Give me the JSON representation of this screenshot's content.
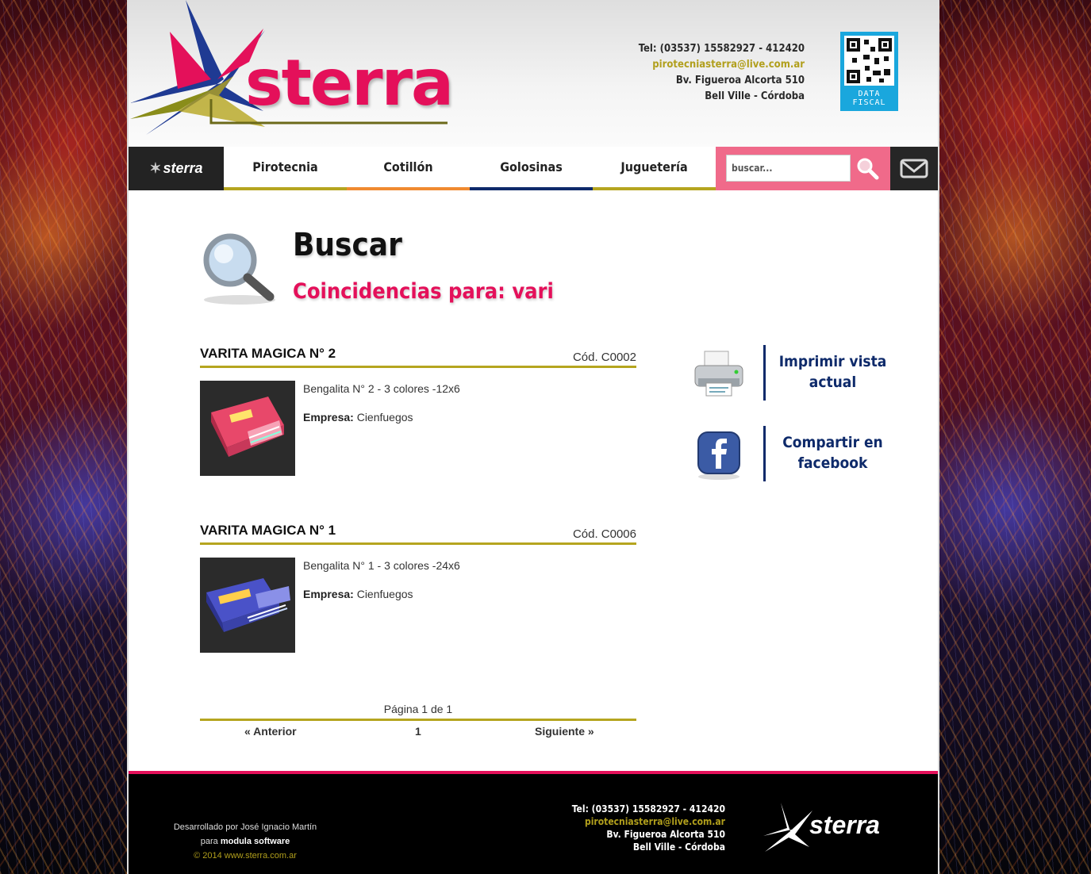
{
  "brand": {
    "name": "sterra",
    "colors": {
      "primary": "#e4105a",
      "accent": "#b5a51f",
      "navy": "#0e2a6a",
      "sky": "#1aa7dd"
    }
  },
  "header": {
    "phone": "Tel: (03537) 15582927 - 412420",
    "email": "pirotecniasterra@live.com.ar",
    "address": "Bv. Figueroa Alcorta 510",
    "city": "Bell Ville - Córdoba",
    "qr_label_1": "DATA",
    "qr_label_2": "FISCAL"
  },
  "nav": {
    "logo_label": "sterra",
    "items": [
      {
        "label": "Pirotecnia",
        "color": "#b5a51f"
      },
      {
        "label": "Cotillón",
        "color": "#f08a30"
      },
      {
        "label": "Golosinas",
        "color": "#0e2a6a"
      },
      {
        "label": "Juguetería",
        "color": "#b5a51f"
      }
    ],
    "search_placeholder": "buscar...",
    "search_icon": "magnifier-icon",
    "mail_icon": "envelope-icon"
  },
  "page": {
    "title": "Buscar",
    "subtitle": "Coincidencias para: vari"
  },
  "products": [
    {
      "name": "VARITA MAGICA N° 2",
      "code": "Cód. C0002",
      "description": "Bengalita N° 2 - 3 colores -12x6",
      "company_label": "Empresa:",
      "company": "Cienfuegos",
      "box_color": "#e8486a"
    },
    {
      "name": "VARITA MAGICA N° 1",
      "code": "Cód. C0006",
      "description": "Bengalita N° 1 - 3 colores -24x6",
      "company_label": "Empresa:",
      "company": "Cienfuegos",
      "box_color": "#4a52c8"
    }
  ],
  "pagination": {
    "info": "Página 1 de 1",
    "prev": "« Anterior",
    "current": "1",
    "next": "Siguiente »"
  },
  "actions": {
    "print_label": "Imprimir vista actual",
    "share_label": "Compartir en facebook"
  },
  "footer": {
    "dev_line_1": "Desarrollado por José Ignacio Martín",
    "dev_line_2_prefix": "para",
    "dev_line_2_company": "modula software",
    "copyright": "© 2014 www.sterra.com.ar",
    "phone": "Tel: (03537) 15582927 - 412420",
    "email": "pirotecniasterra@live.com.ar",
    "address": "Bv. Figueroa Alcorta 510",
    "city": "Bell Ville - Córdoba",
    "logo_label": "sterra"
  }
}
